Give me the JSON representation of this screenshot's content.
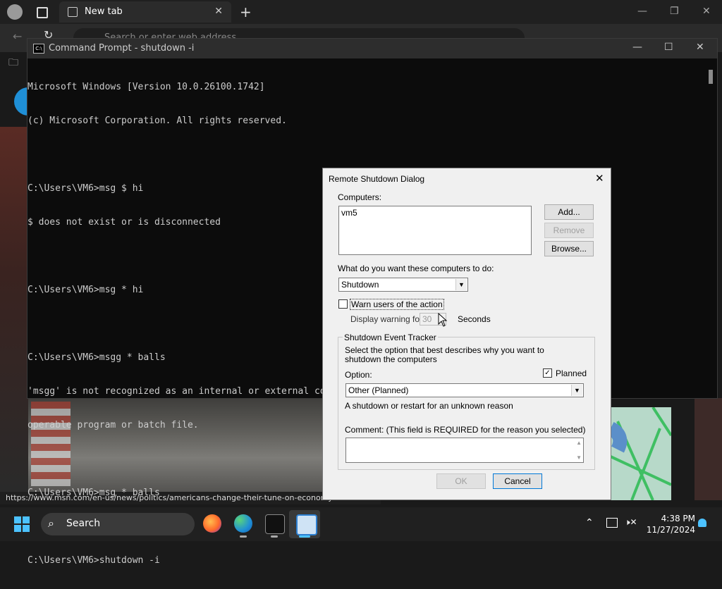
{
  "browser": {
    "tab_title": "New tab",
    "address_placeholder": "Search or enter web address",
    "status_url": "https://www.msn.com/en-us/news/politics/americans-change-their-tune-on-economy"
  },
  "cmd": {
    "title": "Command Prompt - shutdown  -i",
    "lines": [
      "Microsoft Windows [Version 10.0.26100.1742]",
      "(c) Microsoft Corporation. All rights reserved.",
      "",
      "C:\\Users\\VM6>msg $ hi",
      "$ does not exist or is disconnected",
      "",
      "C:\\Users\\VM6>msg * hi",
      "",
      "C:\\Users\\VM6>msgg * balls",
      "'msgg' is not recognized as an internal or external command,",
      "operable program or batch file.",
      "",
      "C:\\Users\\VM6>msg * balls",
      "",
      "C:\\Users\\VM6>shutdown -i"
    ]
  },
  "dialog": {
    "title": "Remote Shutdown Dialog",
    "computers_label": "Computers:",
    "computers_list": [
      "vm5"
    ],
    "add_button": "Add...",
    "remove_button": "Remove",
    "browse_button": "Browse...",
    "action_label": "What do you want these computers to do:",
    "action_value": "Shutdown",
    "warn_label": "Warn users of the action",
    "display_warning_label": "Display warning for",
    "warning_seconds": "30",
    "seconds_label": "Seconds",
    "tracker_title": "Shutdown Event Tracker",
    "tracker_desc": "Select the option that best describes why you want to shutdown the computers",
    "option_label": "Option:",
    "planned_label": "Planned",
    "option_value": "Other (Planned)",
    "reason_desc": "A shutdown or restart for an unknown reason",
    "comment_label": "Comment:  (This field is REQUIRED for the reason you selected)",
    "ok_button": "OK",
    "cancel_button": "Cancel"
  },
  "taskbar": {
    "search_label": "Search",
    "time": "4:38 PM",
    "date": "11/27/2024"
  }
}
